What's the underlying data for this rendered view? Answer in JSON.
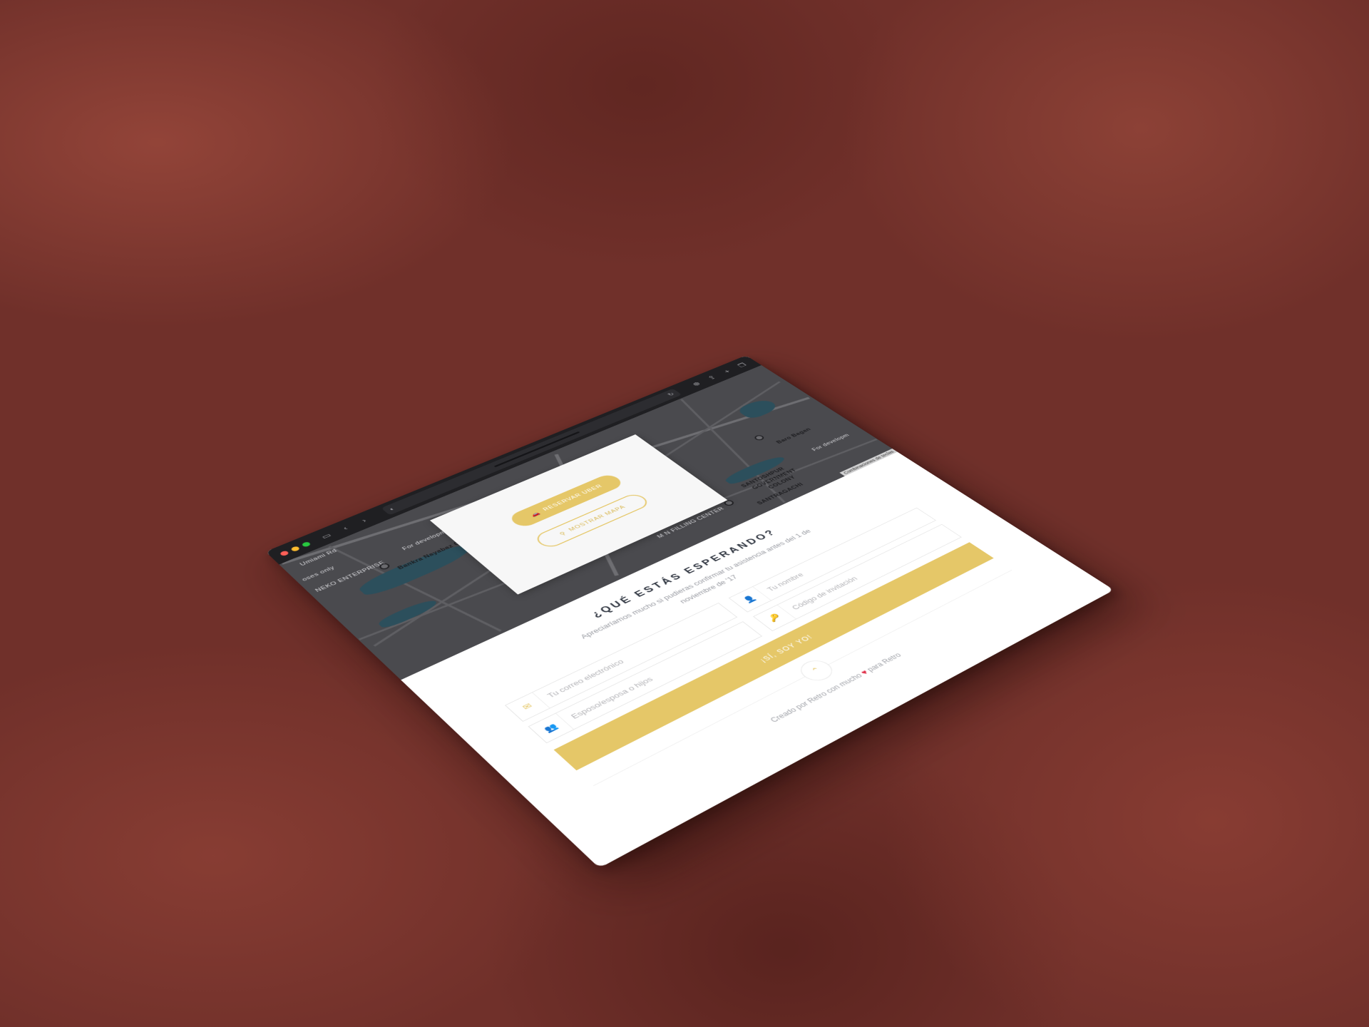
{
  "browser": {
    "address_text": "",
    "icons": {
      "sidebar": "sidebar-icon",
      "back": "chevron-left-icon",
      "forward": "chevron-right-icon",
      "shield": "shield-icon",
      "reload": "reload-icon",
      "download": "download-icon",
      "share": "share-icon",
      "new_tab": "plus-icon",
      "tabs": "tabs-icon"
    }
  },
  "map": {
    "labels": [
      "Umiami Rd",
      "oses only",
      "NEKO ENTERPRISE",
      "For developm",
      "Bankra Nayabaz Cabin",
      "M N FILLING CENTER",
      "SANTOSHPUR",
      "GOVERNMENT",
      "COLONY",
      "SANTRAGACHI",
      "Baro Bagan",
      "For developm"
    ],
    "attribution": "Combinaciones de teclas",
    "reserve_button": "RESERVAR UBER",
    "map_button": "MOSTRAR MAPA"
  },
  "rsvp": {
    "title": "¿QUÉ ESTÁS ESPERANDO?",
    "subtitle": "Apreciaríamos mucho si pudieras confirmar tu asistencia antes del 1 de noviembre de '17",
    "fields": {
      "email_placeholder": "Tu correo electrónico",
      "name_placeholder": "Tu nombre",
      "guests_placeholder": "Esposo/esposa o hijos",
      "code_placeholder": "Código de invitación"
    },
    "submit_label": "¡SÍ, SOY YO!"
  },
  "footer": {
    "credit_before": "Creado por Retro con mucho",
    "credit_after": "para Retro"
  },
  "colors": {
    "accent": "#e5c768",
    "heart": "#e0334c",
    "background": "#70302a"
  }
}
